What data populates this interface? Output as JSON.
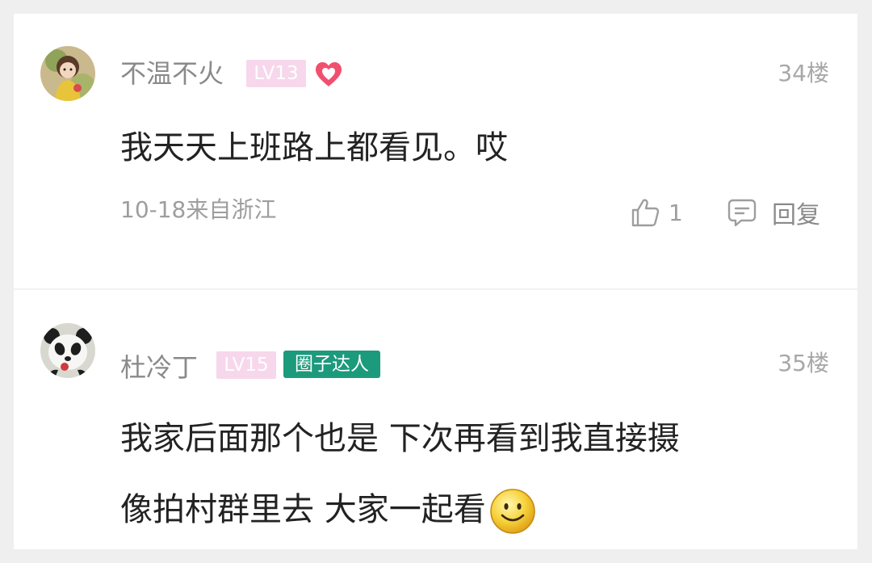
{
  "comments": [
    {
      "username": "不温不火",
      "level": "LV13",
      "floor": "34楼",
      "text": "我天天上班路上都看见。哎",
      "meta": "10-18来自浙江",
      "likes": "1",
      "reply_label": "回复",
      "avatar_icon": "girl-avatar-icon",
      "extra_icon": "heart-icon"
    },
    {
      "username": "杜冷丁",
      "level": "LV15",
      "badge": "圈子达人",
      "floor": "35楼",
      "text_line1": "我家后面那个也是 下次再看到我直接摄",
      "text_line2": "像拍村群里去 大家一起看",
      "avatar_icon": "panda-avatar-icon",
      "emoji_icon": "smiley-emoji-icon"
    }
  ],
  "colors": {
    "level_badge": "#f7d7ec",
    "expert_badge": "#1c9a7c",
    "heart": "#f0506e",
    "username": "#8a8a8a"
  }
}
